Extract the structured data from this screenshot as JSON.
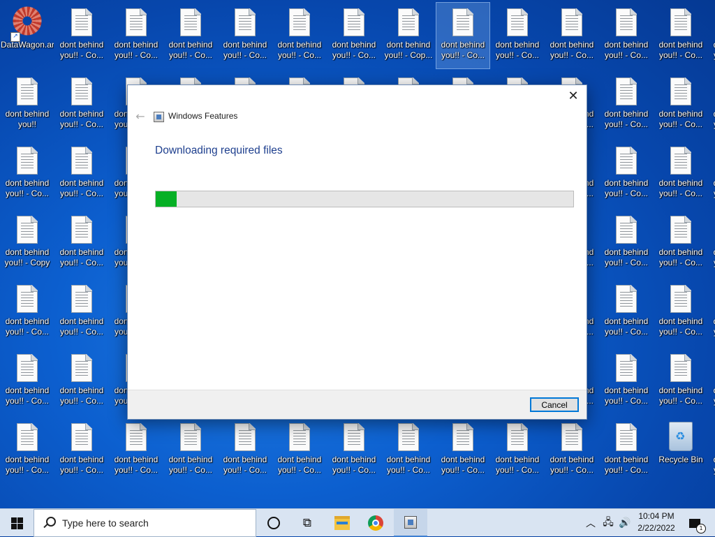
{
  "desktop": {
    "app_icon": {
      "label_line1": "DataWagon.ar",
      "label_line2": ""
    },
    "doc_label_line1": "dont behind",
    "doc_labels_line2": {
      "copy_trunc": "you!! - Co...",
      "copy_trunc2": "you!! - Cop...",
      "copy": "you!! - Copy",
      "plain": "you!!"
    },
    "recycle_bin_label": "Recycle Bin"
  },
  "dialog": {
    "title": "Windows Features",
    "heading": "Downloading required files",
    "progress_percent": 5,
    "progress_color": "#06b025",
    "cancel_label": "Cancel",
    "close_glyph": "✕",
    "back_glyph": "←"
  },
  "taskbar": {
    "search_placeholder": "Type here to search",
    "time": "10:04 PM",
    "date": "2/22/2022",
    "notification_count": "1",
    "pinned": [
      "start-icon",
      "cortana-icon",
      "task-view-icon",
      "file-explorer-icon",
      "chrome-icon",
      "windows-features-icon"
    ]
  }
}
